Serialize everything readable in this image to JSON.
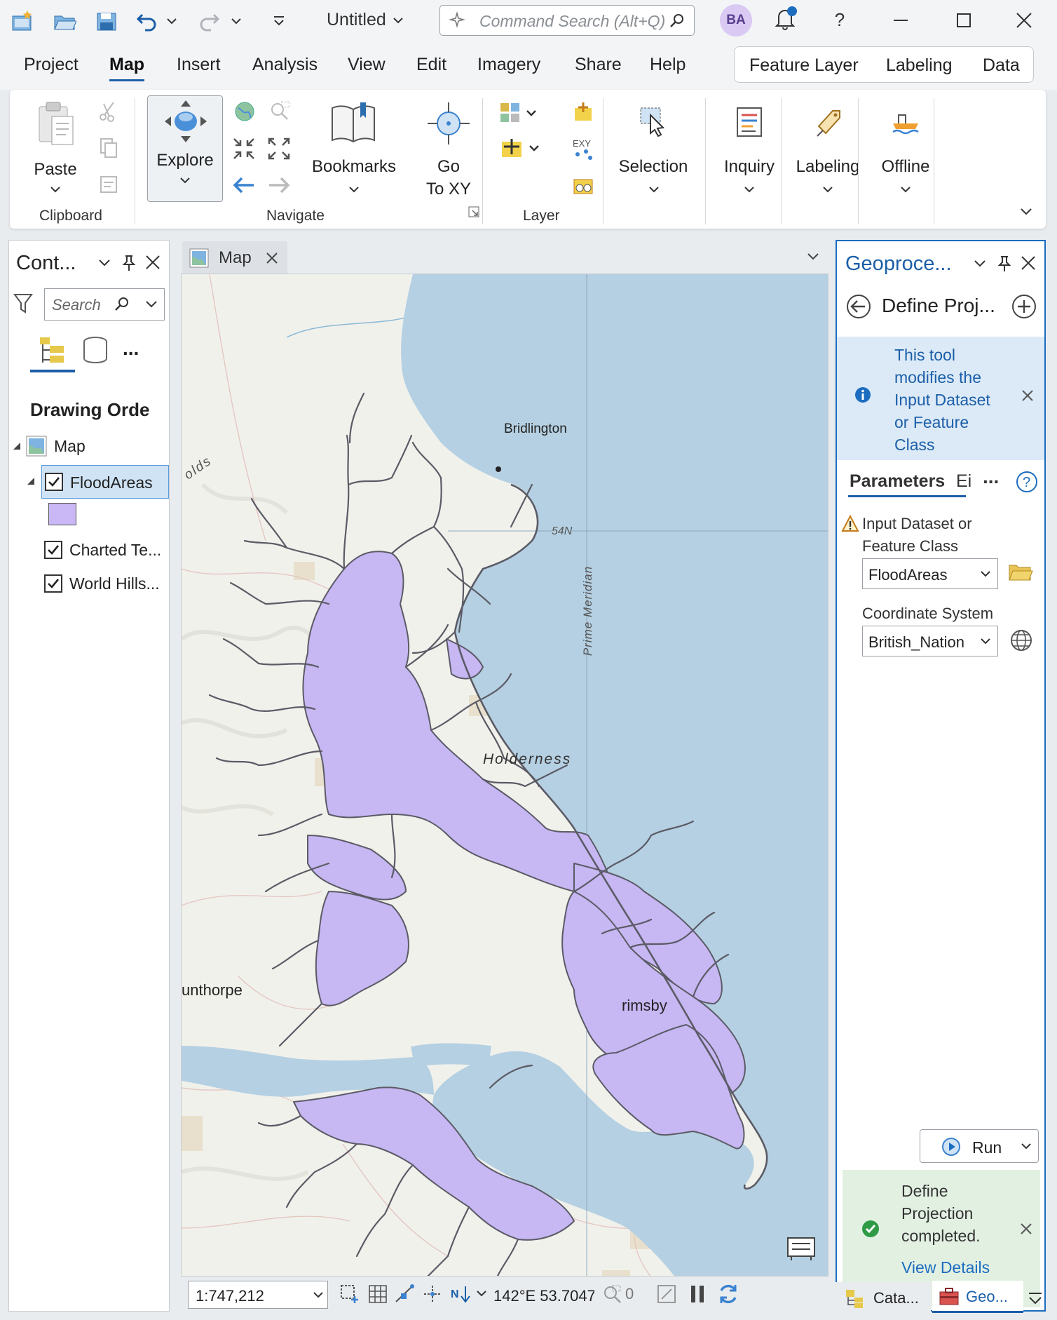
{
  "window": {
    "title": "Untitled",
    "command_search_placeholder": "Command Search (Alt+Q)",
    "user_initials": "BA",
    "help_label": "?",
    "accent_color": "#1c5fa8"
  },
  "menu": {
    "tabs": [
      "Project",
      "Map",
      "Insert",
      "Analysis",
      "View",
      "Edit",
      "Imagery",
      "Share",
      "Help"
    ],
    "active_tab": "Map",
    "contextual_tabs": [
      "Feature Layer",
      "Labeling",
      "Data"
    ]
  },
  "ribbon": {
    "paste": "Paste",
    "explore": "Explore",
    "bookmarks": "Bookmarks",
    "go_to_xy_line1": "Go",
    "go_to_xy_line2": "To XY",
    "selection": "Selection",
    "inquiry": "Inquiry",
    "labeling": "Labeling",
    "offline": "Offline",
    "groups": {
      "clipboard": "Clipboard",
      "navigate": "Navigate",
      "layer": "Layer"
    }
  },
  "contents": {
    "title": "Cont...",
    "search_placeholder": "Search",
    "more": "...",
    "drawing_order": "Drawing Orde",
    "map_item": "Map",
    "layers": [
      {
        "name": "FloodAreas",
        "checked": true,
        "selected": true,
        "symbol_color": "#c9b8f5"
      },
      {
        "name": "Charted Te...",
        "checked": true
      },
      {
        "name": "World Hills...",
        "checked": true
      }
    ]
  },
  "map": {
    "tab_label": "Map",
    "labels": {
      "bridlington": "Bridlington",
      "holderness": "Holderness",
      "wolds": "olds",
      "parallel": "54N",
      "meridian": "Prime Meridian",
      "scunthorpe": "unthorpe",
      "grimsby": "rimsby"
    },
    "colors": {
      "sea": "#b5d0e2",
      "land": "#f1f1ec",
      "flood": "#c7b7f3",
      "outline": "#5b5b66"
    },
    "status": {
      "scale": "1:747,212",
      "coordinates": "142°E 53.704787",
      "selected_count": "0"
    }
  },
  "geoprocessing": {
    "title": "Geoproce...",
    "tool_title": "Define Proj...",
    "info_message": "This tool modifies the Input Dataset or Feature Class",
    "tabs": [
      "Parameters",
      "Ei"
    ],
    "more": "...",
    "param1_label_line1": "Input Dataset or",
    "param1_label_line2": "Feature Class",
    "param1_value": "FloodAreas",
    "param2_label": "Coordinate System",
    "param2_value": "British_Nation",
    "run_label": "Run",
    "success_message_line1": "Define",
    "success_message_line2": "Projection",
    "success_message_line3": "completed.",
    "view_details": "View Details"
  },
  "bottom_tabs": [
    "Cata...",
    "Geo..."
  ]
}
